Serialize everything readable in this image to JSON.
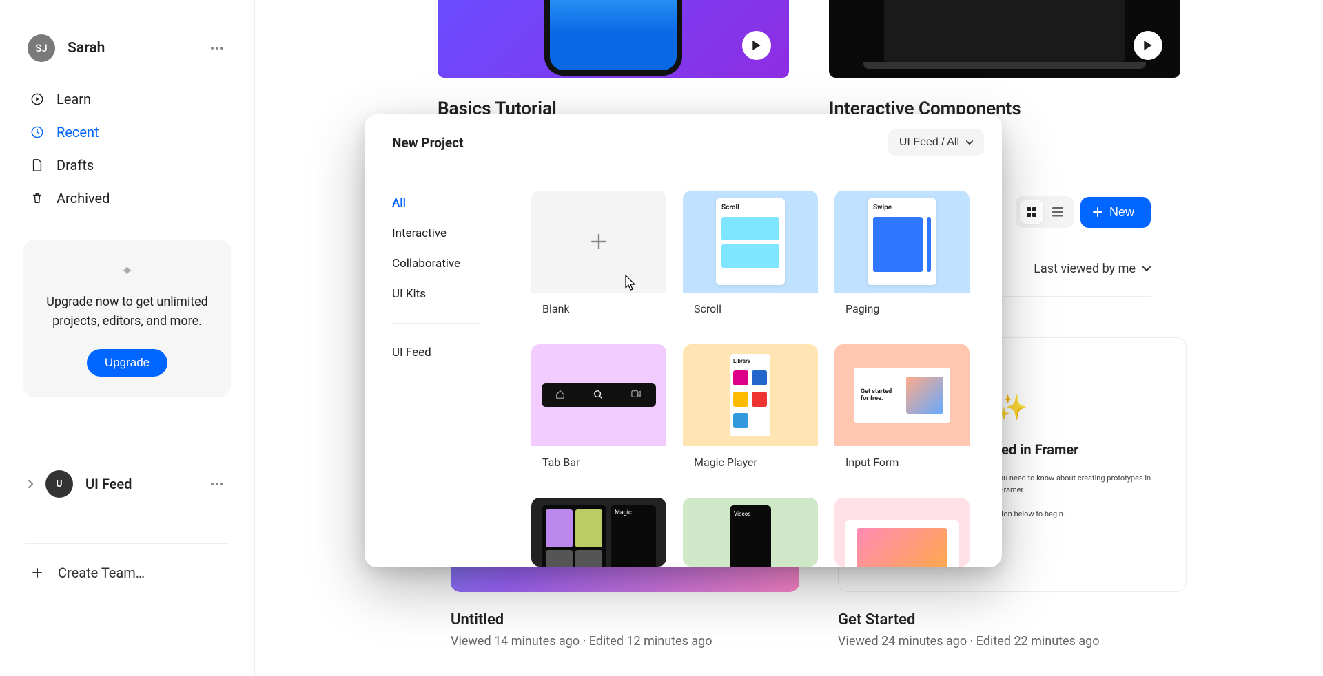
{
  "sidebar": {
    "avatar_initials": "SJ",
    "profile_name": "Sarah",
    "nav": [
      {
        "icon": "play-circle-icon",
        "label": "Learn",
        "active": false
      },
      {
        "icon": "clock-icon",
        "label": "Recent",
        "active": true
      },
      {
        "icon": "file-icon",
        "label": "Drafts",
        "active": false
      },
      {
        "icon": "trash-icon",
        "label": "Archived",
        "active": false
      }
    ],
    "upgrade": {
      "text": "Upgrade now to get unlimited projects, editors, and more.",
      "button": "Upgrade"
    },
    "feed": {
      "initial": "U",
      "label": "UI Feed"
    },
    "create_team": "Create Team…"
  },
  "tutorials": [
    {
      "title": "Basics Tutorial",
      "style": "purple"
    },
    {
      "title": "Interactive Components",
      "style": "black"
    }
  ],
  "toolbar": {
    "new_label": "New",
    "sort_label": "Last viewed by me"
  },
  "projects": [
    {
      "title": "Untitled",
      "viewed": "Viewed 14 minutes ago",
      "edited": "Edited 12 minutes ago",
      "thumb": "grad1"
    },
    {
      "title": "Get Started",
      "viewed": "Viewed 24 minutes ago",
      "edited": "Edited 22 minutes ago",
      "thumb": "doc",
      "doc": {
        "heading": "Get Started in Framer",
        "p1": "In this project you'll learn everything you need to know about creating prototypes in Framer.",
        "p2": "Click the button below to begin."
      }
    }
  ],
  "modal": {
    "title": "New Project",
    "filter": "UI Feed / All",
    "nav": [
      "All",
      "Interactive",
      "Collaborative",
      "UI Kits"
    ],
    "nav_after": [
      "UI Feed"
    ],
    "templates": [
      {
        "name": "Blank",
        "kind": "blank"
      },
      {
        "name": "Scroll",
        "kind": "scroll",
        "mock_label": "Scroll"
      },
      {
        "name": "Paging",
        "kind": "paging",
        "mock_label": "Swipe"
      },
      {
        "name": "Tab Bar",
        "kind": "tabbar"
      },
      {
        "name": "Magic Player",
        "kind": "magic",
        "mock_label": "Library"
      },
      {
        "name": "Input Form",
        "kind": "form",
        "mock_label": "Get started for free."
      },
      {
        "name": "",
        "kind": "ph1",
        "mock_label": "Magic"
      },
      {
        "name": "",
        "kind": "ph2",
        "mock_label": "Videos"
      },
      {
        "name": "",
        "kind": "ph3"
      }
    ]
  }
}
